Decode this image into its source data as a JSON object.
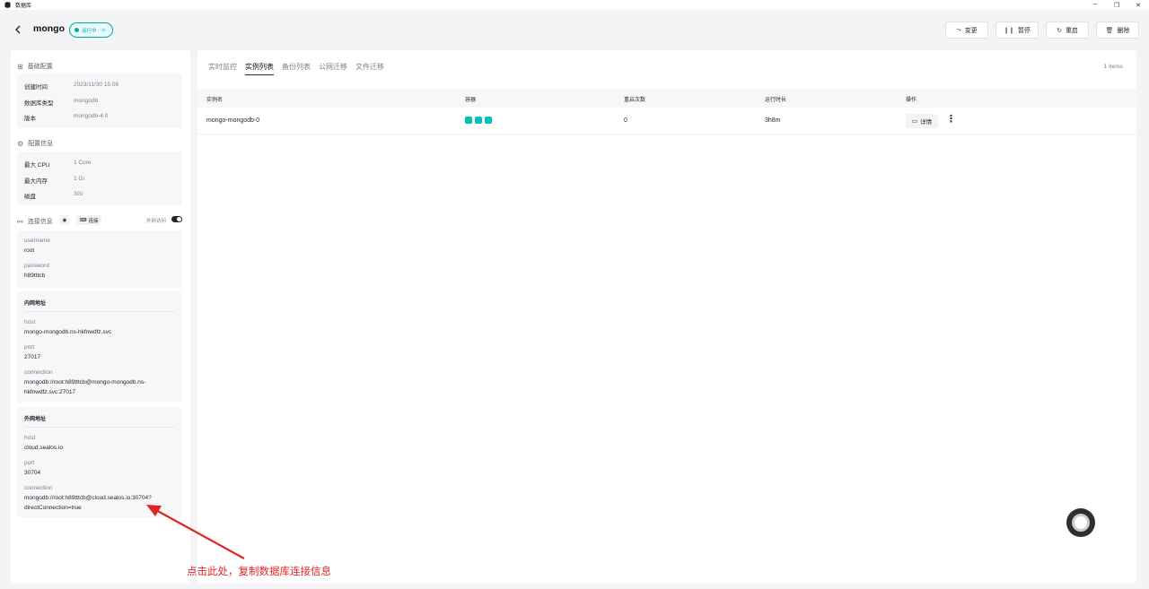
{
  "window": {
    "title": "数据库"
  },
  "header": {
    "db_name": "mongo",
    "status": "运行中",
    "actions": [
      "变更",
      "暂停",
      "重启",
      "删除"
    ]
  },
  "basic": {
    "title": "基础配置",
    "rows": [
      {
        "k": "创建时间",
        "v": "2023/11/30 15:06"
      },
      {
        "k": "数据库类型",
        "v": "mongodb"
      },
      {
        "k": "版本",
        "v": "mongodb-4.0"
      }
    ]
  },
  "config": {
    "title": "配置信息",
    "rows": [
      {
        "k": "最大 CPU",
        "v": "1 Core"
      },
      {
        "k": "最大内存",
        "v": "1 Gi"
      },
      {
        "k": "磁盘",
        "v": "3Gi"
      }
    ]
  },
  "connection": {
    "title": "连接信息",
    "connect_label": "连接",
    "external_access_label": "外网访问",
    "external_access_on": true,
    "username_label": "username",
    "username": "root",
    "password_label": "password",
    "password": "h89tttcb",
    "internal": {
      "title": "内网地址",
      "host_label": "host",
      "host": "mongo-mongodb.ns-hkfnwdfz.svc",
      "port_label": "port",
      "port": "27017",
      "connection_label": "connection",
      "connection_line1": "mongodb://root:h89tttcb@mongo-mongodb.ns-",
      "connection_line2": "hkfnwdfz.svc:27017"
    },
    "external": {
      "title": "外网地址",
      "host_label": "host",
      "host": "cloud.sealos.io",
      "port_label": "port",
      "port": "30704",
      "connection_label": "connection",
      "connection_line1": "mongodb://root:h89tttcb@cloud.sealos.io:30704?",
      "connection_line2": "directConnection=true"
    }
  },
  "tabs": [
    "实时监控",
    "实例列表",
    "备份列表",
    "公网迁移",
    "文件迁移"
  ],
  "active_tab": "实例列表",
  "items_count": "1 Items",
  "table": {
    "headers": [
      "实例名",
      "容器",
      "重启次数",
      "运行时长",
      "操作"
    ],
    "rows": [
      {
        "name": "mongo-mongodb-0",
        "containers": 3,
        "restarts": "0",
        "uptime": "3h8m",
        "detail_label": "详情"
      }
    ]
  },
  "annotation": "点击此处，复制数据库连接信息",
  "colors": {
    "accent": "#00a9a6",
    "pod": "#00c2b5",
    "annotation": "#e02424"
  }
}
